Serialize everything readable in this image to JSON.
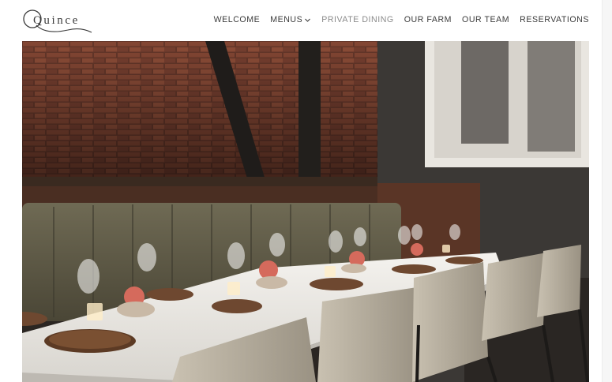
{
  "brand": {
    "name": "Quince"
  },
  "nav": {
    "items": [
      {
        "label": "WELCOME",
        "active": false
      },
      {
        "label": "MENUS",
        "active": false,
        "has_dropdown": true
      },
      {
        "label": "PRIVATE DINING",
        "active": true
      },
      {
        "label": "OUR FARM",
        "active": false
      },
      {
        "label": "OUR TEAM",
        "active": false
      },
      {
        "label": "RESERVATIONS",
        "active": false
      }
    ]
  },
  "colors": {
    "nav_text": "#3b3b3b",
    "nav_active": "#8a8a8a",
    "background": "#ffffff"
  },
  "hero": {
    "subject": "private dining room photo",
    "icon": "hero-photo"
  }
}
